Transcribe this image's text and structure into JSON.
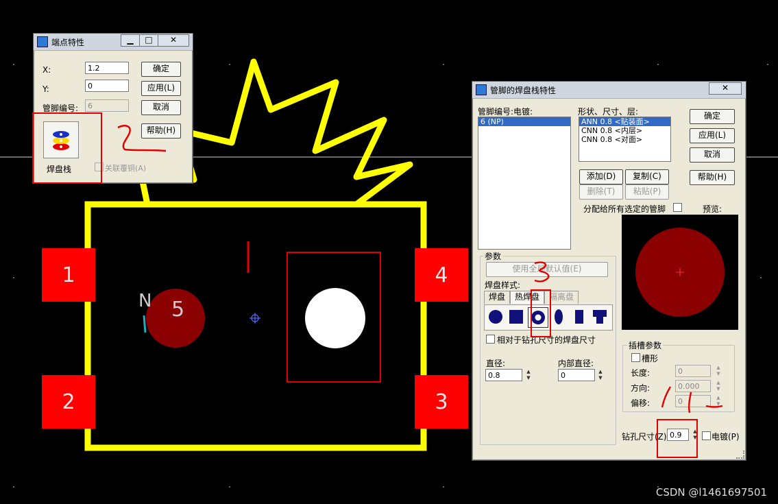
{
  "colors": {
    "pad_red": "#ff0000",
    "outline_yellow": "#ffff00",
    "via_darkred": "#8b0000",
    "annotation_red": "#e00000"
  },
  "board": {
    "pads": [
      {
        "label": "1"
      },
      {
        "label": "2"
      },
      {
        "label": "3"
      },
      {
        "label": "4"
      }
    ],
    "pad5_label": "5",
    "n_text": "N",
    "watermark": "CSDN @l1461697501"
  },
  "annotations": {
    "one": "1",
    "two": "2",
    "three": "3"
  },
  "endpoint_dialog": {
    "title": "端点特性",
    "x_label": "X:",
    "x_value": "1.2",
    "y_label": "Y:",
    "y_value": "0",
    "pin_label": "管脚编号:",
    "pin_value": "6",
    "ok": "确定",
    "apply": "应用(L)",
    "cancel": "取消",
    "help": "帮助(H)",
    "padstack_label": "焊盘栈",
    "link_copper": "关联覆铜(A)"
  },
  "padstack_dialog": {
    "title": "管脚的焊盘栈特性",
    "pin_plating_label": "管脚编号:电镀:",
    "pin_items": [
      "6 (NP)"
    ],
    "shape_label": "形状、尺寸、层:",
    "shape_items": [
      "ANN 0.8 <贴装面>",
      "CNN 0.8 <内层>",
      "CNN 0.8 <对面>"
    ],
    "ok": "确定",
    "apply": "应用(L)",
    "cancel": "取消",
    "help": "帮助(H)",
    "add": "添加(D)",
    "copy": "复制(C)",
    "delete": "删除(T)",
    "paste": "粘贴(P)",
    "assign_all": "分配给所有选定的管脚",
    "preview": "预览:",
    "params": "参数",
    "use_defaults": "使用全局默认值(E)",
    "pad_style": "焊盘样式:",
    "tabs": [
      "焊盘",
      "热焊盘",
      "隔离盘"
    ],
    "relative": "相对于钻孔尺寸的焊盘尺寸",
    "diameter_label": "直径:",
    "diameter_value": "0.8",
    "inner_label": "内部直径:",
    "inner_value": "0",
    "slot_params": "插槽参数",
    "slot": "槽形",
    "length_label": "长度:",
    "length_value": "0",
    "direction_label": "方向:",
    "direction_value": "0.000",
    "offset_label": "偏移:",
    "offset_value": "0",
    "drill_label": "钻孔尺寸(Z):",
    "drill_value": "0.9",
    "plated": "电镀(P)"
  }
}
